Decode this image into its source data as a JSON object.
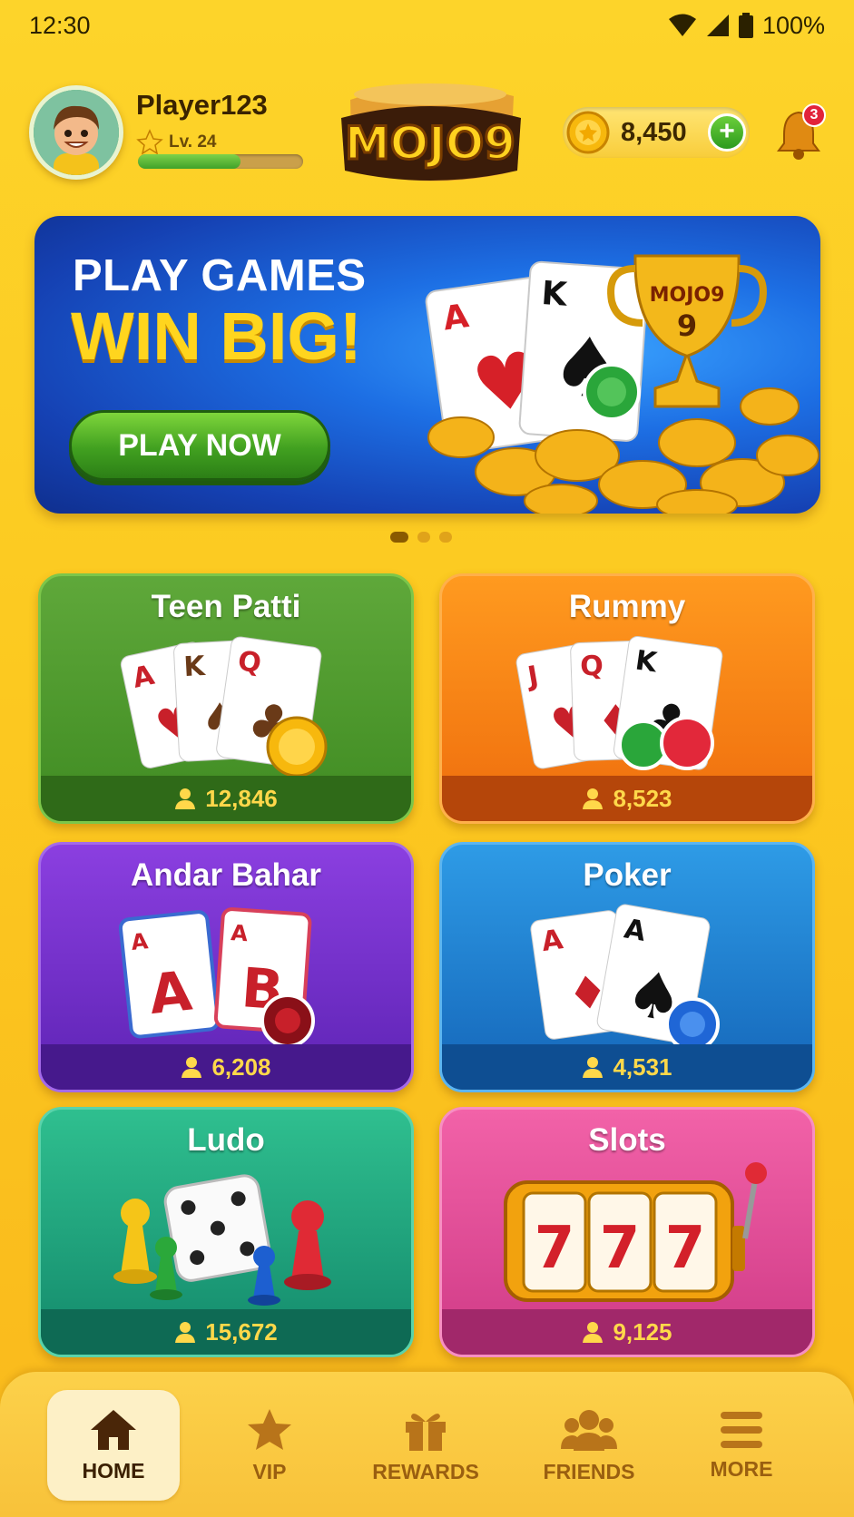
{
  "status_bar": {
    "time": "12:30",
    "battery": "100%"
  },
  "header": {
    "player_name": "Player123",
    "level": "Lv. 24",
    "xp_progress": 0.62,
    "logo_text": "MOJO9",
    "coins": "8,450",
    "notifications": "3"
  },
  "banner": {
    "line1": "PLAY GAMES",
    "line2": "WIN BIG!",
    "cta": "PLAY NOW",
    "trophy_text": "MOJO9",
    "trophy_number": "9",
    "slide_count": 3,
    "active_slide": 1
  },
  "games": [
    {
      "name": "Teen Patti",
      "players": "12,846"
    },
    {
      "name": "Rummy",
      "players": "8,523"
    },
    {
      "name": "Andar Bahar",
      "players": "6,208"
    },
    {
      "name": "Poker",
      "players": "4,531"
    },
    {
      "name": "Ludo",
      "players": "15,672"
    },
    {
      "name": "Slots",
      "players": "9,125"
    }
  ],
  "nav": [
    {
      "label": "HOME",
      "icon": "home-icon",
      "active": true
    },
    {
      "label": "VIP",
      "icon": "star-icon",
      "active": false
    },
    {
      "label": "REWARDS",
      "icon": "gift-icon",
      "active": false
    },
    {
      "label": "FRIENDS",
      "icon": "friends-icon",
      "active": false
    },
    {
      "label": "MORE",
      "icon": "menu-icon",
      "active": false
    }
  ],
  "colors": {
    "background": "#fcc920",
    "accent_green": "#41a020",
    "coin_gold": "#ffd51e"
  }
}
